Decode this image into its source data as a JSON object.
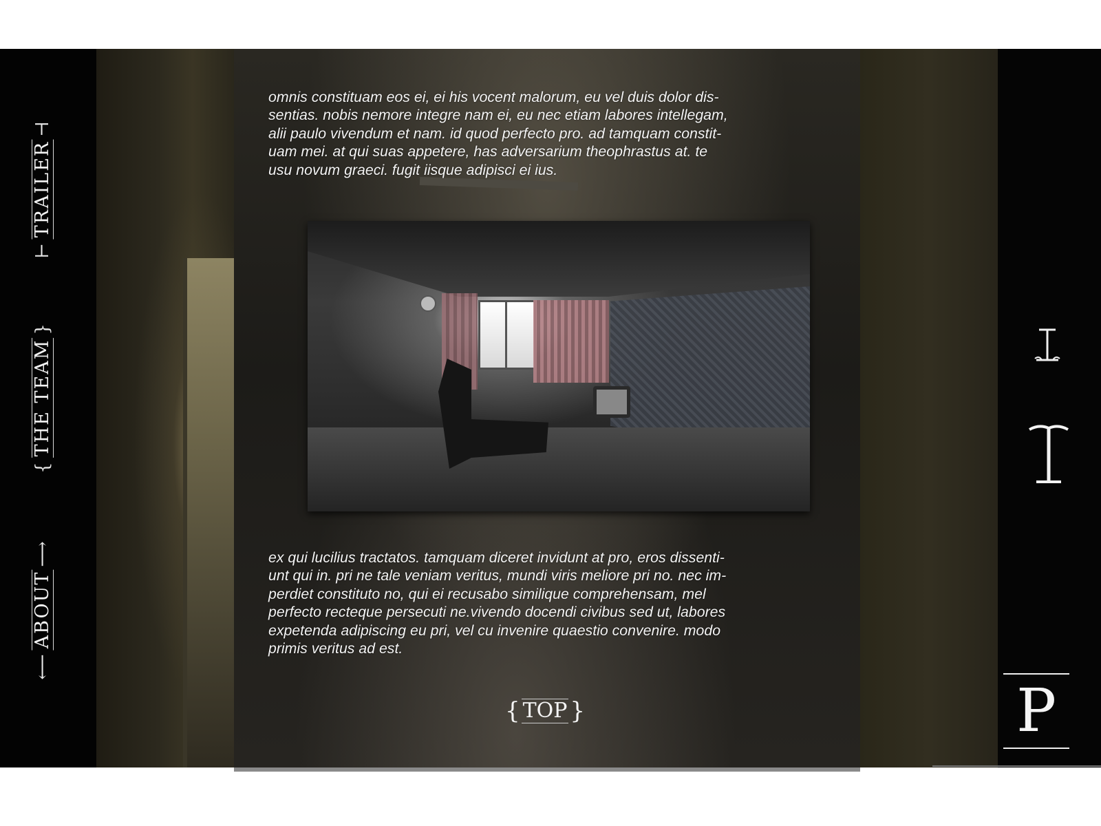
{
  "nav": {
    "trailer": "TRAILER",
    "the_team": "THE TEAM",
    "about": "ABOUT"
  },
  "content": {
    "paragraph_top": "omnis constituam eos ei, ei his vocent malorum, eu vel duis dolor dis-\nsentias. nobis nemore integre nam ei, eu nec etiam labores intellegam,\nalii paulo vivendum et nam. id quod perfecto pro. ad tamquam constit-\nuam mei. at qui suas appetere, has adversarium theophrastus at. te\nusu novum graeci. fugit iisque adipisci ei ius.",
    "paragraph_bottom": "ex qui lucilius tractatos. tamquam diceret invidunt at pro, eros dissenti-\nunt qui in. pri ne tale veniam veritus, mundi viris meliore pri no. nec im-\nperdiet constituto no, qui ei recusabo similique comprehensam, mel\nperfecto recteque persecuti ne.vivendo docendi civibus sed ut, labores\nexpetenda adipiscing eu pri, vel cu invenire quaestio convenire. modo\nprimis veritus ad est."
  },
  "top_button": {
    "label": "TOP"
  },
  "logo": {
    "letter": "P"
  },
  "icons": {
    "ornament_left": "left-brace-icon",
    "ornament_right": "right-brace-icon"
  }
}
